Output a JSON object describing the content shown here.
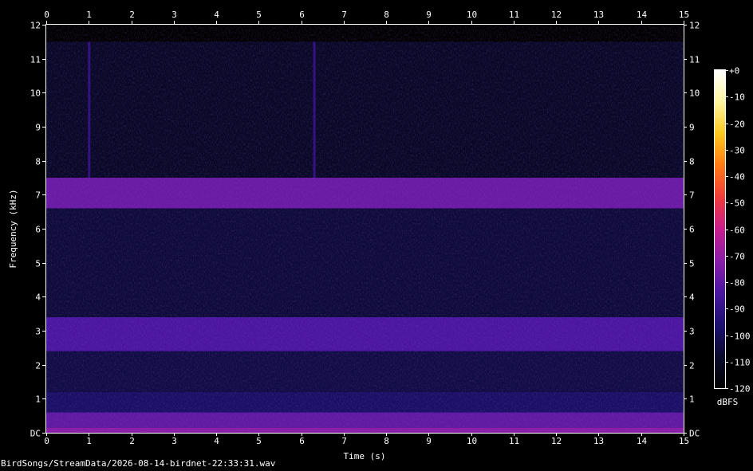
{
  "chart_data": {
    "type": "heatmap",
    "title": "",
    "xlabel": "Time (s)",
    "ylabel": "Frequency (kHz)",
    "xlim": [
      0,
      15
    ],
    "ylim": [
      0,
      12
    ],
    "x_ticks": [
      "0",
      "1",
      "2",
      "3",
      "4",
      "5",
      "6",
      "7",
      "8",
      "9",
      "10",
      "11",
      "12",
      "13",
      "14",
      "15"
    ],
    "y_ticks": [
      "DC",
      "1",
      "2",
      "3",
      "4",
      "5",
      "6",
      "7",
      "8",
      "9",
      "10",
      "11",
      "12"
    ],
    "signal_top_khz": 11.5,
    "colorbar": {
      "label": "dBFS",
      "ticks": [
        "+0",
        "-10",
        "-20",
        "-30",
        "-40",
        "-50",
        "-60",
        "-70",
        "-80",
        "-90",
        "-100",
        "-110",
        "-120"
      ],
      "range": [
        -120,
        0
      ]
    },
    "bands_khz_dbfs": [
      {
        "low": 0.0,
        "high": 0.15,
        "level": -72
      },
      {
        "low": 0.15,
        "high": 0.6,
        "level": -80
      },
      {
        "low": 0.6,
        "high": 1.2,
        "level": -98
      },
      {
        "low": 1.2,
        "high": 2.4,
        "level": -104
      },
      {
        "low": 2.4,
        "high": 3.4,
        "level": -84
      },
      {
        "low": 3.4,
        "high": 6.6,
        "level": -106
      },
      {
        "low": 6.6,
        "high": 7.5,
        "level": -78
      },
      {
        "low": 7.5,
        "high": 11.5,
        "level": -110
      }
    ],
    "transients": [
      {
        "time_s": 1.0,
        "low_khz": 7.5,
        "high_khz": 11.5
      },
      {
        "time_s": 6.3,
        "low_khz": 7.5,
        "high_khz": 11.5
      }
    ]
  },
  "footer": {
    "filename": "BirdSongs/StreamData/2026-08-14-birdnet-22:33:31.wav"
  },
  "colors": {
    "background": "#000000",
    "axis": "#ffffff",
    "colormap": [
      "#000000",
      "#0a0a2e",
      "#1c1070",
      "#4a16a0",
      "#8a1ea8",
      "#c81e8c",
      "#f03c3c",
      "#ff7a14",
      "#ffc81e",
      "#fff5a0",
      "#ffffff"
    ]
  }
}
